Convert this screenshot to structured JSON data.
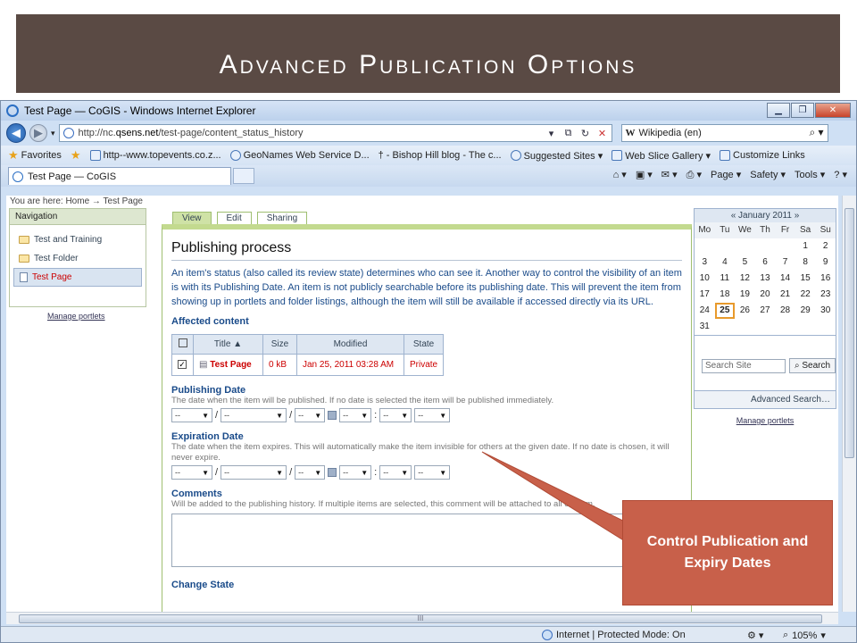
{
  "slide": {
    "title": "Advanced Publication Options"
  },
  "window": {
    "title": "Test Page — CoGIS - Windows Internet Explorer",
    "url_prefix": "http://nc.",
    "url_domain": "qsens.net",
    "url_suffix": "/test-page/content_status_history",
    "search_engine": "Wikipedia (en)",
    "favorites_label": "Favorites",
    "favorites": [
      "http--www.topevents.co.z...",
      "GeoNames Web Service D...",
      "- Bishop Hill blog - The c...",
      "Suggested Sites ▾",
      "Web Slice Gallery ▾",
      "Customize Links"
    ],
    "tab_title": "Test Page — CoGIS",
    "commands": [
      "Page ▾",
      "Safety ▾",
      "Tools ▾"
    ],
    "status_zone": "Internet | Protected Mode: On",
    "zoom": "105%",
    "hscroll_label": "III"
  },
  "page": {
    "breadcrumb": "You are here: Home → Test Page",
    "nav_title": "Navigation",
    "nav_items": [
      "Test and Training",
      "Test Folder",
      "Test Page"
    ],
    "manage_portlets": "Manage portlets",
    "tabs": [
      "View",
      "Edit",
      "Sharing"
    ],
    "heading": "Publishing process",
    "description": "An item's status (also called its review state) determines who can see it. Another way to control the visibility of an item is with its Publishing Date. An item is not publicly searchable before its publishing date. This will prevent the item from showing up in portlets and folder listings, although the item will still be available if accessed directly via its URL.",
    "affected_label": "Affected content",
    "table": {
      "headers": [
        "Title ▲",
        "Size",
        "Modified",
        "State"
      ],
      "row": {
        "title": "Test Page",
        "size": "0 kB",
        "modified": "Jan 25, 2011 03:28 AM",
        "state": "Private",
        "checked": "✓"
      }
    },
    "publishing_label": "Publishing Date",
    "publishing_help": "The date when the item will be published. If no date is selected the item will be published immediately.",
    "expiration_label": "Expiration Date",
    "expiration_help": "The date when the item expires. This will automatically make the item invisible for others at the given date. If no date is chosen, it will never expire.",
    "comments_label": "Comments",
    "comments_help": "Will be added to the publishing history. If multiple items are selected, this comment will be attached to all of them.",
    "select_default": "--",
    "bottom_cut": "Change State"
  },
  "calendar": {
    "month": "« January 2011 »",
    "days": [
      "Mo",
      "Tu",
      "We",
      "Th",
      "Fr",
      "Sa",
      "Su"
    ],
    "cells": [
      "",
      "",
      "",
      "",
      "",
      "1",
      "2",
      "3",
      "4",
      "5",
      "6",
      "7",
      "8",
      "9",
      "10",
      "11",
      "12",
      "13",
      "14",
      "15",
      "16",
      "17",
      "18",
      "19",
      "20",
      "21",
      "22",
      "23",
      "24",
      "25",
      "26",
      "27",
      "28",
      "29",
      "30",
      "31",
      "",
      "",
      "",
      "",
      "",
      ""
    ],
    "today": "25"
  },
  "search": {
    "placeholder": "Search Site",
    "button": "Search",
    "advanced": "Advanced Search…"
  },
  "callout": {
    "text": "Control Publication and Expiry Dates",
    "color": "#c8604a"
  }
}
